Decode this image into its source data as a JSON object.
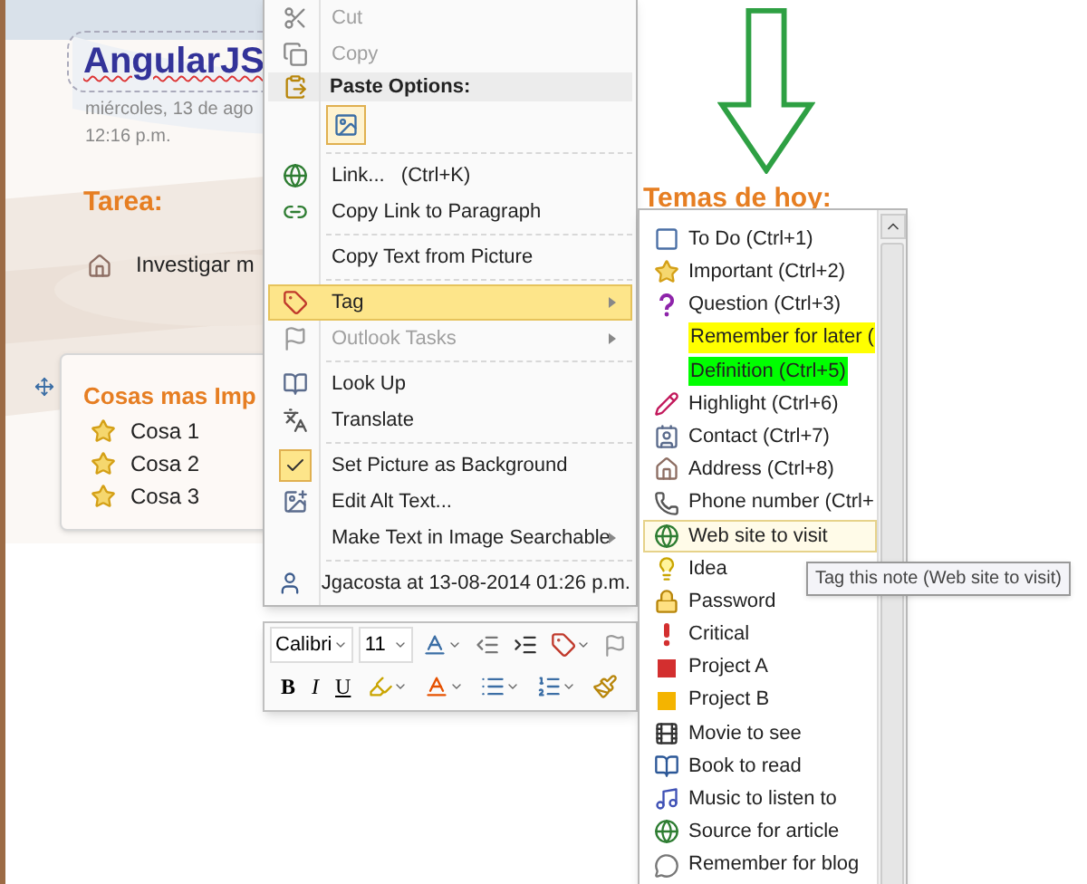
{
  "page": {
    "title": "AngularJS",
    "date": "miércoles, 13 de ago",
    "time": "12:16 p.m.",
    "task_heading": "Tarea:",
    "task": "Investigar m",
    "topics_heading": "Temas de hoy:",
    "box": {
      "heading": "Cosas mas Imp",
      "items": [
        "Cosa 1",
        "Cosa 2",
        "Cosa 3"
      ]
    }
  },
  "context_menu": {
    "items": [
      {
        "kind": "item",
        "label": "Cut",
        "disabled": true,
        "selected": false,
        "checked": false,
        "submenu": false
      },
      {
        "kind": "item",
        "label": "Copy",
        "disabled": true,
        "selected": false,
        "checked": false,
        "submenu": false
      },
      {
        "kind": "header",
        "label": "Paste Options:"
      },
      {
        "kind": "paste"
      },
      {
        "kind": "separator"
      },
      {
        "kind": "item",
        "label": "Link...",
        "shortcut": "(Ctrl+K)",
        "disabled": false,
        "selected": false,
        "checked": false,
        "submenu": false
      },
      {
        "kind": "item",
        "label": "Copy Link to Paragraph",
        "disabled": false,
        "selected": false,
        "checked": false,
        "submenu": false
      },
      {
        "kind": "separator"
      },
      {
        "kind": "item",
        "label": "Copy Text from Picture",
        "disabled": false,
        "selected": false,
        "checked": false,
        "submenu": false
      },
      {
        "kind": "separator"
      },
      {
        "kind": "item",
        "label": "Tag",
        "disabled": false,
        "selected": true,
        "checked": false,
        "submenu": true
      },
      {
        "kind": "item",
        "label": "Outlook Tasks",
        "disabled": true,
        "selected": false,
        "checked": false,
        "submenu": true
      },
      {
        "kind": "separator"
      },
      {
        "kind": "item",
        "label": "Look Up",
        "disabled": false,
        "selected": false,
        "checked": false,
        "submenu": false
      },
      {
        "kind": "item",
        "label": "Translate",
        "disabled": false,
        "selected": false,
        "checked": false,
        "submenu": false
      },
      {
        "kind": "separator"
      },
      {
        "kind": "item",
        "label": "Set Picture as Background",
        "disabled": false,
        "selected": false,
        "checked": true,
        "submenu": false
      },
      {
        "kind": "item",
        "label": "Edit Alt Text...",
        "disabled": false,
        "selected": false,
        "checked": false,
        "submenu": false
      },
      {
        "kind": "item",
        "label": "Make Text in Image Searchable",
        "disabled": false,
        "selected": false,
        "checked": false,
        "submenu": true
      },
      {
        "kind": "separator"
      },
      {
        "kind": "item",
        "label": "Jgacosta at 13-08-2014 01:26 p.m.",
        "disabled": false,
        "selected": false,
        "checked": false,
        "submenu": false
      }
    ]
  },
  "mini_toolbar": {
    "font": "Calibri",
    "size": "11",
    "bold": "B",
    "italic": "I",
    "underline": "U"
  },
  "tags": {
    "items": [
      {
        "label": "To Do (Ctrl+1)",
        "selected": false
      },
      {
        "label": "Important (Ctrl+2)",
        "selected": false
      },
      {
        "label": "Question (Ctrl+3)",
        "selected": false
      },
      {
        "label": "Remember for later (",
        "selected": false,
        "color": "#ffff00"
      },
      {
        "label": "Definition (Ctrl+5)",
        "selected": false,
        "color": "#00ff00"
      },
      {
        "label": "Highlight (Ctrl+6)",
        "selected": false
      },
      {
        "label": "Contact (Ctrl+7)",
        "selected": false
      },
      {
        "label": "Address (Ctrl+8)",
        "selected": false
      },
      {
        "label": "Phone number (Ctrl+",
        "selected": false
      },
      {
        "label": "Web site to visit",
        "selected": true
      },
      {
        "label": "Idea",
        "selected": false
      },
      {
        "label": "Password",
        "selected": false
      },
      {
        "label": "Critical",
        "selected": false
      },
      {
        "label": "Project A",
        "selected": false
      },
      {
        "label": "Project B",
        "selected": false
      },
      {
        "label": "Movie to see",
        "selected": false
      },
      {
        "label": "Book to read",
        "selected": false
      },
      {
        "label": "Music to listen to",
        "selected": false
      },
      {
        "label": "Source for article",
        "selected": false
      },
      {
        "label": "Remember for blog",
        "selected": false
      }
    ]
  },
  "tooltip": "Tag this note (Web site to visit)"
}
